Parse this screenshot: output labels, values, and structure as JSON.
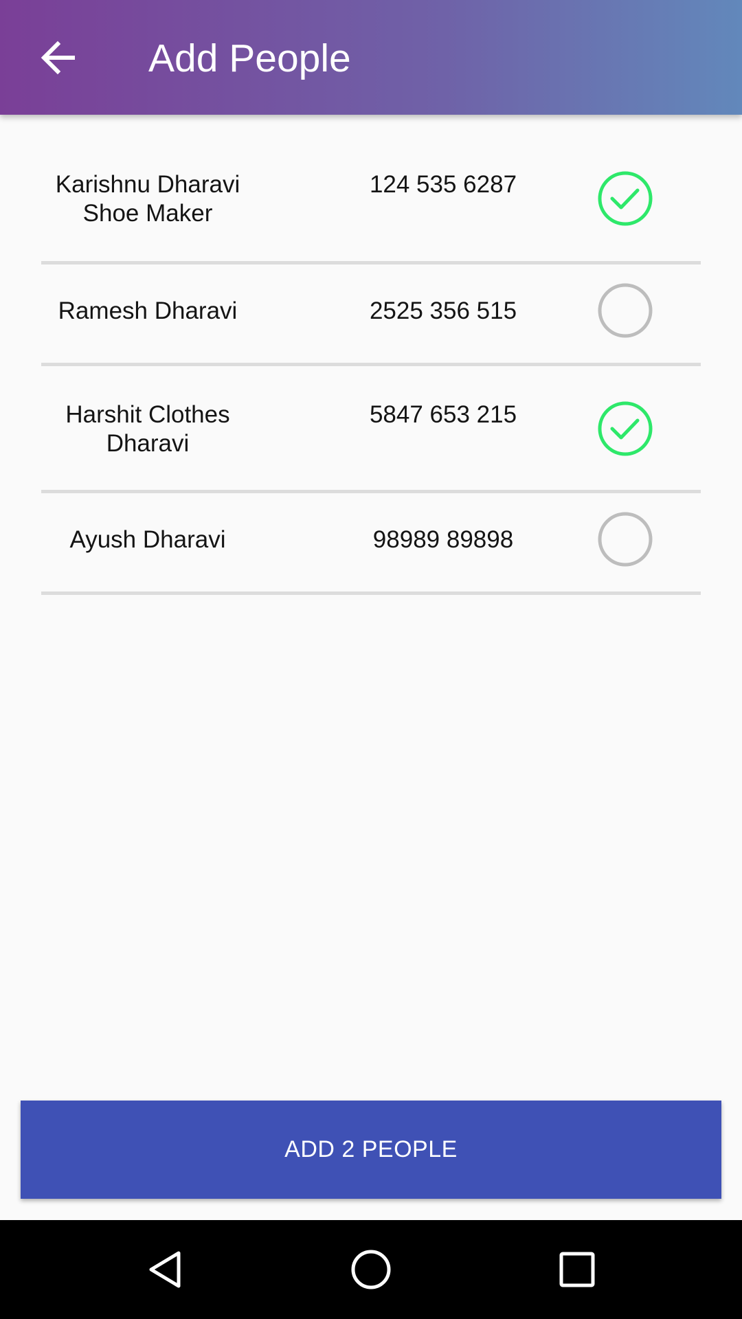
{
  "appbar": {
    "title": "Add People",
    "back_icon": "arrow-back-icon",
    "gradient": [
      "#7a3f97",
      "#6288bb"
    ]
  },
  "contacts": [
    {
      "name_line1": "Karishnu Dharavi",
      "name_line2": "Shoe Maker",
      "phone": "124 535 6287",
      "selected": true
    },
    {
      "name_line1": "Ramesh Dharavi",
      "name_line2": "",
      "phone": "2525 356 515",
      "selected": false
    },
    {
      "name_line1": "Harshit Clothes",
      "name_line2": "Dharavi",
      "phone": "5847 653 215",
      "selected": true
    },
    {
      "name_line1": "Ayush Dharavi",
      "name_line2": "",
      "phone": "98989 89898",
      "selected": false
    }
  ],
  "action": {
    "add_label": "ADD 2 PEOPLE",
    "color": "#3f51b5"
  },
  "colors": {
    "selected": "#2ee86a",
    "unselected": "#bdbdbd"
  },
  "navbar": {
    "back_icon": "nav-back-icon",
    "home_icon": "nav-home-icon",
    "recents_icon": "nav-recents-icon"
  }
}
